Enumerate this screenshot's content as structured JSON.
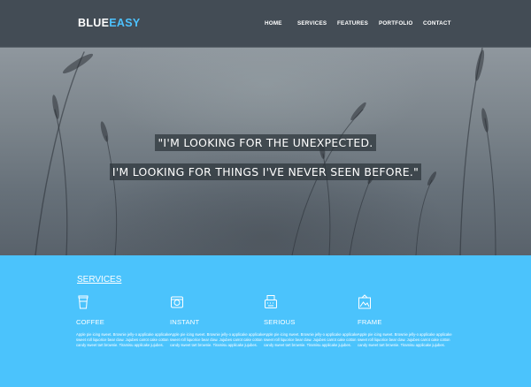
{
  "header": {
    "logo_part1": "BLUE",
    "logo_part2": "EASY",
    "nav": [
      "HOME",
      "SERVICES",
      "FEATURES",
      "PORTFOLIO",
      "CONTACT"
    ]
  },
  "hero": {
    "line1": "\"I'M LOOKING FOR THE UNEXPECTED.",
    "line2": "I'M LOOKING FOR THINGS I'VE NEVER SEEN BEFORE.\""
  },
  "services": {
    "title": "SERVICES",
    "items": [
      {
        "name": "COFFEE",
        "icon": "coffee-cup-icon",
        "desc": "Apple pie icing sweet. Brownie jelly-o applicake applicake sweet roll liquorice bear claw. Jujubes carrot cake cotton candy sweet tart brownie. Tiramisu applicake jujubes."
      },
      {
        "name": "INSTANT",
        "icon": "camera-icon",
        "desc": "Apple pie icing sweet. Brownie jelly-o applicake applicake sweet roll liquorice bear claw. Jujubes carrot cake cotton candy sweet tart brownie. Tiramisu applicake jujubes."
      },
      {
        "name": "SERIOUS",
        "icon": "typewriter-icon",
        "desc": "Apple pie icing sweet. Brownie jelly-o applicake applicake sweet roll liquorice bear claw. Jujubes carrot cake cotton candy sweet tart brownie. Tiramisu applicake jujubes."
      },
      {
        "name": "FRAME",
        "icon": "picture-frame-icon",
        "desc": "Apple pie icing sweet. Brownie jelly-o applicake applicake sweet roll liquorice bear claw. Jujubes carrot cake cotton candy sweet tart brownie. Tiramisu applicake jujubes."
      }
    ]
  },
  "colors": {
    "header_bg": "#434c55",
    "accent": "#4dc2ff",
    "services_bg": "#4bc3fc"
  }
}
